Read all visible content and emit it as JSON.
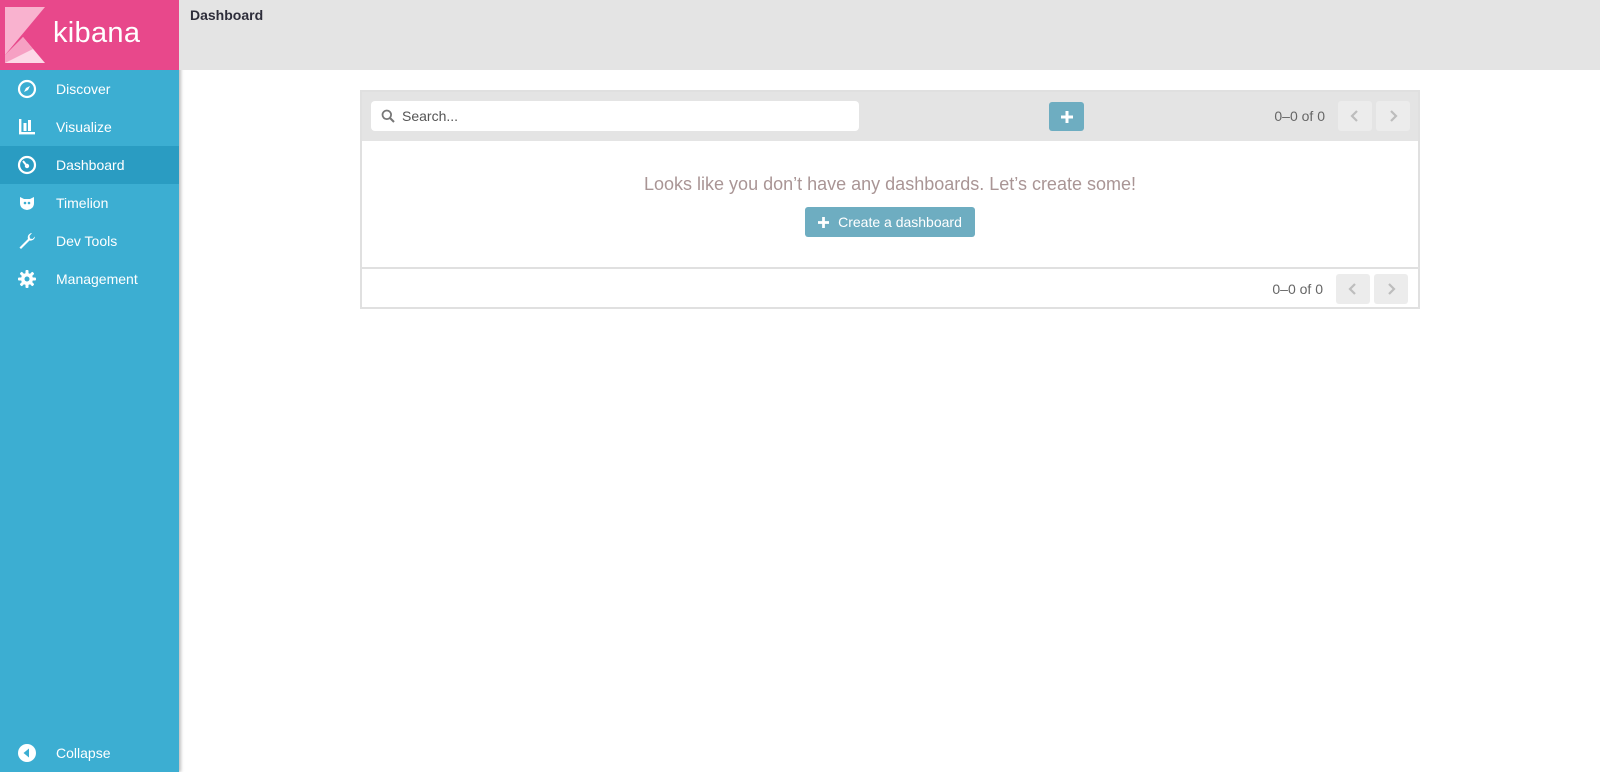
{
  "brand": {
    "name": "kibana",
    "color": "#e8488b",
    "sidebar_color": "#3caed2"
  },
  "sidebar": {
    "items": [
      {
        "label": "Discover",
        "icon": "compass-icon",
        "active": false
      },
      {
        "label": "Visualize",
        "icon": "bar-chart-icon",
        "active": false
      },
      {
        "label": "Dashboard",
        "icon": "dashboard-gauge-icon",
        "active": true
      },
      {
        "label": "Timelion",
        "icon": "timelion-icon",
        "active": false
      },
      {
        "label": "Dev Tools",
        "icon": "wrench-icon",
        "active": false
      },
      {
        "label": "Management",
        "icon": "gear-icon",
        "active": false
      }
    ],
    "collapse_label": "Collapse"
  },
  "topbar": {
    "title": "Dashboard"
  },
  "panel": {
    "search_placeholder": "Search...",
    "pager_text_top": "0–0 of 0",
    "pager_text_bottom": "0–0 of 0",
    "empty_message": "Looks like you don’t have any dashboards. Let’s create some!",
    "create_label": "Create a dashboard",
    "button_color": "#6eadc1"
  }
}
